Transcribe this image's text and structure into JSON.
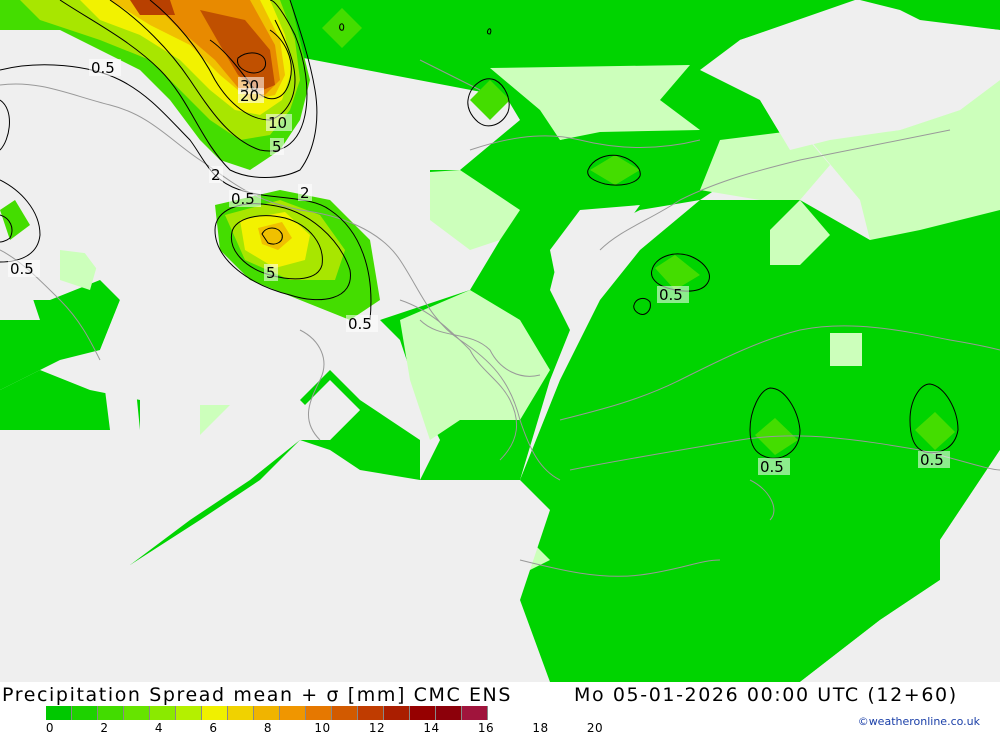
{
  "map": {
    "contour_labels": [
      "0.5",
      "30",
      "20",
      "10",
      "5",
      "2",
      "0.5",
      "2",
      "0.5",
      "5",
      "0.5",
      "0.5",
      "0.5",
      "0.5"
    ],
    "colors": {
      "sea": "#efefef",
      "spread_0_05": "#ccffbb",
      "spread_05_2": "#00d400",
      "spread_2_4": "#44dd00",
      "spread_4_6": "#a8e600",
      "spread_6_8": "#f2f200",
      "spread_8_10": "#f0c000",
      "spread_10_14": "#e88a00",
      "spread_14_20": "#b84000",
      "coastline": "#999999",
      "contour": "#000000"
    }
  },
  "legend": {
    "title": "Precipitation Spread mean + σ [mm] CMC ENS",
    "valid": "Mo 05-01-2026 00:00 UTC (12+60)",
    "ticks": [
      "0",
      "2",
      "4",
      "6",
      "8",
      "10",
      "12",
      "14",
      "16",
      "18",
      "20"
    ],
    "colors": [
      "#00c800",
      "#1ed200",
      "#42dc00",
      "#66e400",
      "#8aea00",
      "#b4f000",
      "#f0f000",
      "#f0d200",
      "#f0b400",
      "#f09600",
      "#e67800",
      "#d25a00",
      "#c03c00",
      "#aa1e00",
      "#960000",
      "#8c000a",
      "#a0143c"
    ],
    "credit": "©weatheronline.co.uk"
  }
}
